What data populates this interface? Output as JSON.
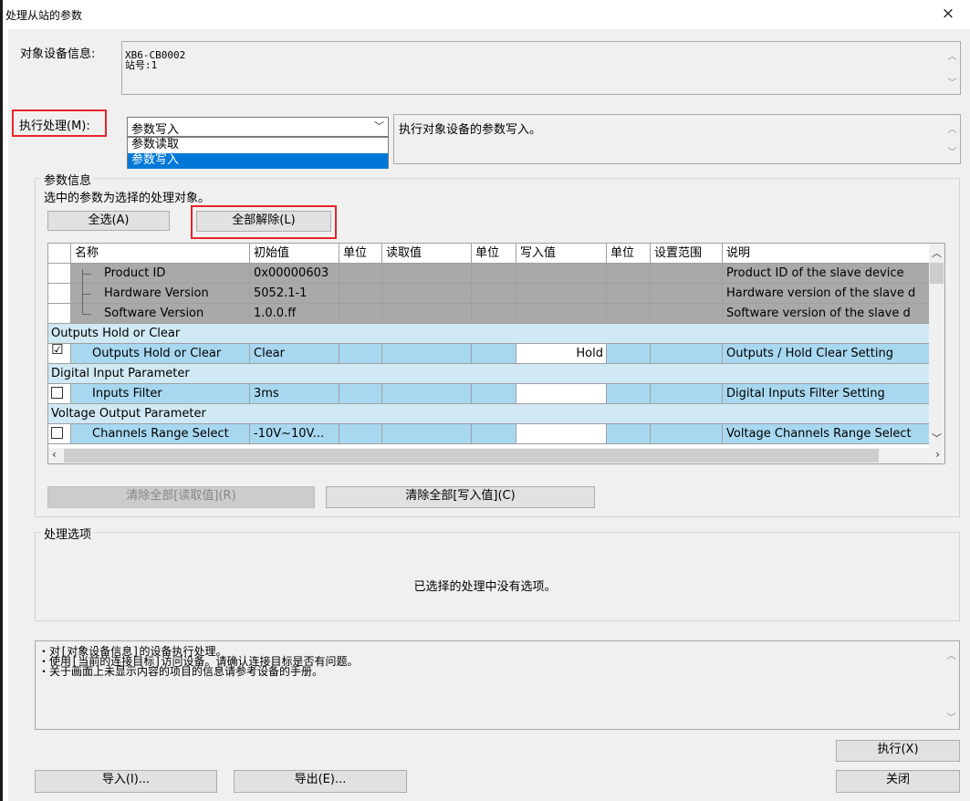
{
  "window": {
    "title": "处理从站的参数",
    "close_glyph": "×"
  },
  "device_info": {
    "label": "对象设备信息:",
    "line1": "XB6-CB0002",
    "line2": "站号:1"
  },
  "execute": {
    "label": "执行处理(M):",
    "selected": "参数写入",
    "options": [
      "参数读取",
      "参数写入"
    ],
    "description": "执行对象设备的参数写入。"
  },
  "params": {
    "legend": "参数信息",
    "hint": "选中的参数为选择的处理对象。",
    "select_all": "全选(A)",
    "clear_all": "全部解除(L)",
    "columns": [
      "名称",
      "初始值",
      "单位",
      "读取值",
      "单位",
      "写入值",
      "单位",
      "设置范围",
      "说明"
    ],
    "rows": [
      {
        "name": "Product ID",
        "initial": "0x00000603",
        "write": "",
        "desc": "Product ID of the slave device"
      },
      {
        "name": "Hardware Version",
        "initial": "5052.1-1",
        "write": "",
        "desc": "Hardware version of the slave d"
      },
      {
        "name": "Software Version",
        "initial": "1.0.0.ff",
        "write": "",
        "desc": "Software version of the slave d"
      }
    ],
    "groups": [
      {
        "title": "Outputs Hold or Clear",
        "row": {
          "checked": "☑",
          "name": "Outputs Hold or Clear",
          "initial": "Clear",
          "write": "Hold",
          "desc": "Outputs / Hold Clear Setting"
        }
      },
      {
        "title": "Digital Input Parameter",
        "row": {
          "checked": "",
          "name": "Inputs Filter",
          "initial": "3ms",
          "write": "",
          "desc": "Digital Inputs Filter Setting"
        }
      },
      {
        "title": "Voltage Output Parameter",
        "row": {
          "checked": "",
          "name": "Channels Range Select",
          "initial": "-10V~10V...",
          "write": "",
          "desc": "Voltage Channels Range Select"
        }
      }
    ],
    "clear_read": "清除全部[读取值](R)",
    "clear_write": "清除全部[写入值](C)"
  },
  "options": {
    "legend": "处理选项",
    "message": "已选择的处理中没有选项。"
  },
  "notes": [
    "・对[对象设备信息]的设备执行处理。",
    "・使用[当前的连接目标]访问设备。请确认连接目标是否有问题。",
    "・关于画面上未显示内容的项目的信息请参考设备的手册。"
  ],
  "buttons": {
    "execute": "执行(X)",
    "import": "导入(I)...",
    "export": "导出(E)...",
    "close": "关闭"
  }
}
